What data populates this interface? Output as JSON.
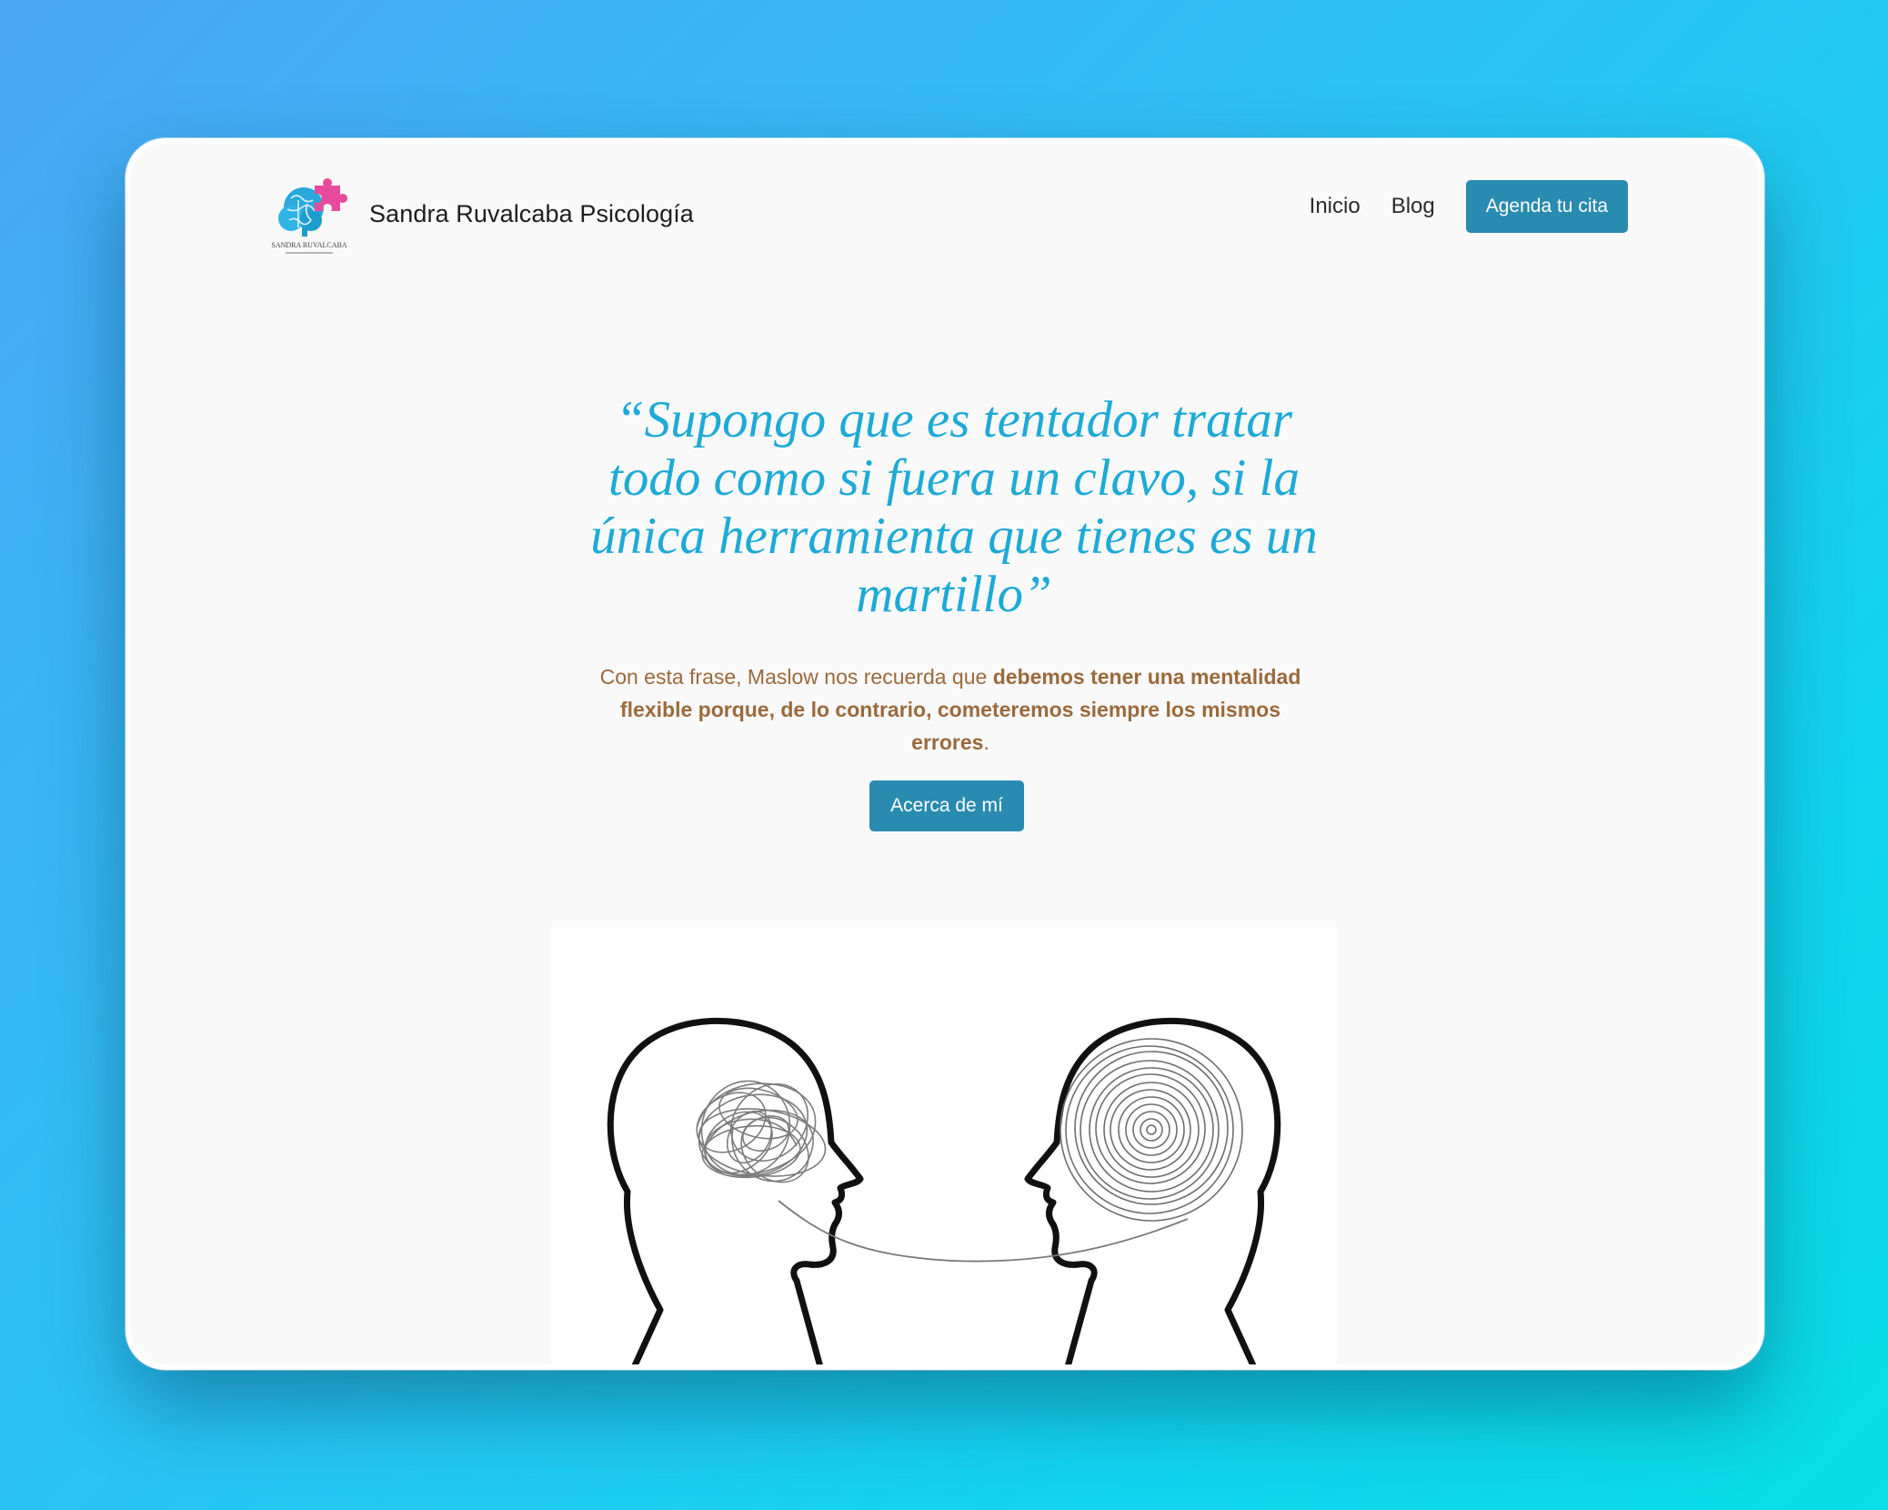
{
  "header": {
    "logo_alt": "SANDRA RUVALCABA",
    "site_title": "Sandra Ruvalcaba Psicología",
    "nav": [
      {
        "label": "Inicio"
      },
      {
        "label": "Blog"
      }
    ],
    "cta_label": "Agenda tu cita"
  },
  "hero": {
    "quote": "“Supongo que es tentador tratar todo como si fuera un clavo, si la única herramienta que tienes es un martillo”",
    "intro_prefix": "Con esta frase, Maslow nos recuerda que ",
    "intro_bold": "debemos tener una mentalidad flexible porque, de lo contrario, cometeremos siempre los mismos errores",
    "intro_suffix": ".",
    "about_button": "Acerca de mí"
  },
  "illustration": {
    "subject": "two-heads-tangled-vs-spiral"
  },
  "colors": {
    "accent": "#2a8bb0",
    "quote": "#1eaad6",
    "body_text": "#9b6a3b",
    "background": "#f9f9f9",
    "logo_brain": "#29a9dc",
    "logo_puzzle": "#e94b9c"
  }
}
